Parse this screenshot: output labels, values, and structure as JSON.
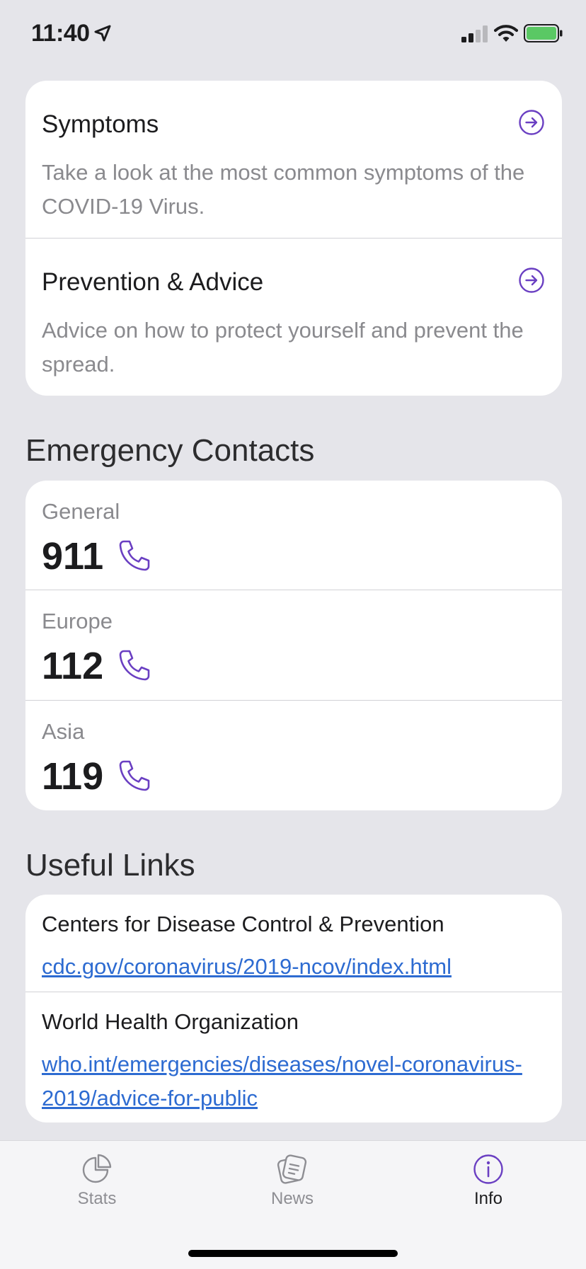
{
  "status_bar": {
    "time": "11:40"
  },
  "info_cards": [
    {
      "title": "Symptoms",
      "description": "Take a look at the most common symptoms of the COVID-19 Virus."
    },
    {
      "title": "Prevention & Advice",
      "description": "Advice on how to protect yourself and prevent the spread."
    }
  ],
  "emergency": {
    "heading": "Emergency Contacts",
    "contacts": [
      {
        "region": "General",
        "number": "911"
      },
      {
        "region": "Europe",
        "number": "112"
      },
      {
        "region": "Asia",
        "number": "119"
      }
    ]
  },
  "links": {
    "heading": "Useful Links",
    "items": [
      {
        "title": "Centers for Disease Control & Prevention",
        "url": "cdc.gov/coronavirus/2019-ncov/index.html"
      },
      {
        "title": "World Health Organization",
        "url": "who.int/emergencies/diseases/novel-coronavirus-2019/advice-for-public"
      }
    ]
  },
  "tabs": [
    {
      "label": "Stats",
      "icon": "pie-chart-icon"
    },
    {
      "label": "News",
      "icon": "news-icon"
    },
    {
      "label": "Info",
      "icon": "info-icon",
      "active": true
    }
  ],
  "colors": {
    "accent": "#6a3fc2",
    "link": "#2d6bd1",
    "background": "#e5e5ea",
    "battery": "#5ac864"
  }
}
